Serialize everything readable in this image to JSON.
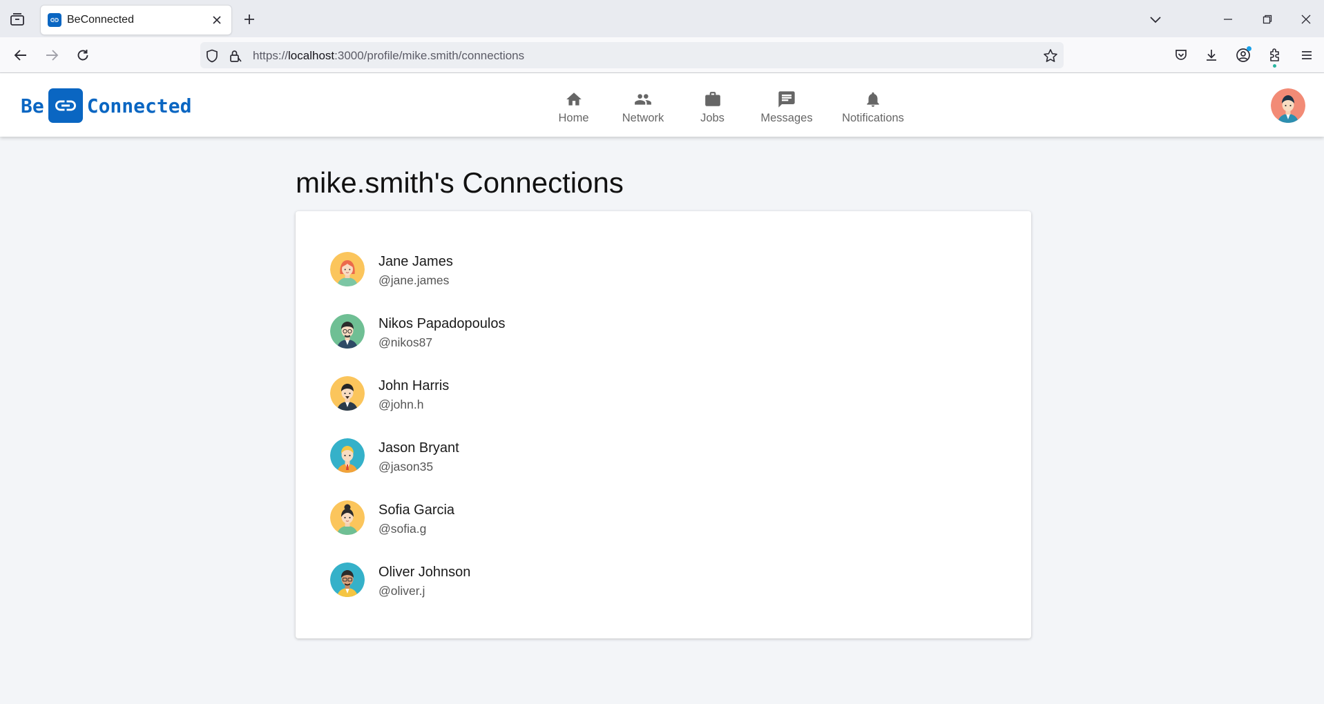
{
  "browser": {
    "tab_title": "BeConnected",
    "url_prefix": "https://",
    "url_host": "localhost",
    "url_path": ":3000/profile/mike.smith/connections"
  },
  "header": {
    "logo_left": "Be",
    "logo_right": "Connected",
    "nav": [
      {
        "label": "Home",
        "icon": "home-icon"
      },
      {
        "label": "Network",
        "icon": "people-icon"
      },
      {
        "label": "Jobs",
        "icon": "briefcase-icon"
      },
      {
        "label": "Messages",
        "icon": "message-icon"
      },
      {
        "label": "Notifications",
        "icon": "bell-icon"
      }
    ]
  },
  "page": {
    "title": "mike.smith's Connections"
  },
  "connections": [
    {
      "name": "Jane James",
      "handle": "@jane.james",
      "avatar_bg": "#fbc55c"
    },
    {
      "name": "Nikos Papadopoulos",
      "handle": "@nikos87",
      "avatar_bg": "#6fbf94"
    },
    {
      "name": "John Harris",
      "handle": "@john.h",
      "avatar_bg": "#fbc55c"
    },
    {
      "name": "Jason Bryant",
      "handle": "@jason35",
      "avatar_bg": "#35b1c9"
    },
    {
      "name": "Sofia Garcia",
      "handle": "@sofia.g",
      "avatar_bg": "#fbc55c"
    },
    {
      "name": "Oliver Johnson",
      "handle": "@oliver.j",
      "avatar_bg": "#35b1c9"
    }
  ],
  "colors": {
    "brand": "#0a66c2",
    "page_bg": "#f3f5f8",
    "header_avatar_bg": "#f28b76"
  }
}
